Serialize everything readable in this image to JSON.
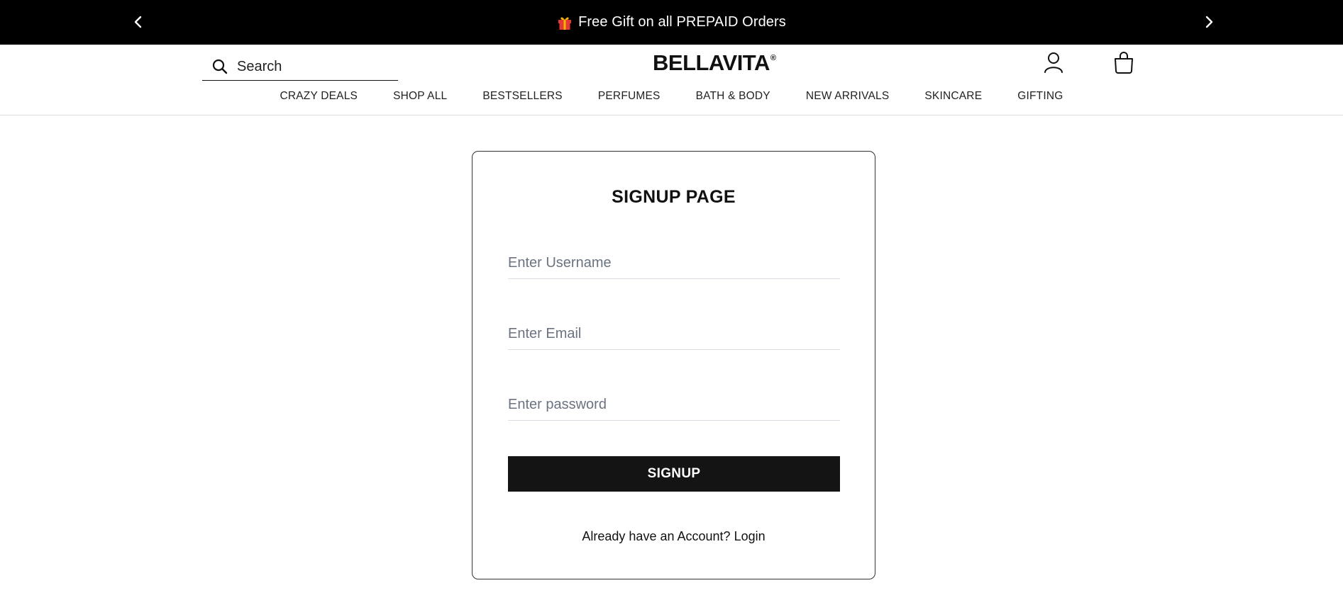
{
  "announcement": {
    "text": "Free Gift on all PREPAID Orders",
    "prev_icon": "chevron-left-icon",
    "next_icon": "chevron-right-icon",
    "gift_icon": "gift-icon"
  },
  "header": {
    "search_placeholder": "Search",
    "logo_text": "BELLAVITA",
    "logo_mark": "®",
    "nav": [
      "CRAZY DEALS",
      "SHOP ALL",
      "BESTSELLERS",
      "PERFUMES",
      "BATH & BODY",
      "NEW ARRIVALS",
      "SKINCARE",
      "GIFTING"
    ]
  },
  "signup": {
    "title": "SIGNUP PAGE",
    "username_placeholder": "Enter Username",
    "email_placeholder": "Enter Email",
    "password_placeholder": "Enter password",
    "button_label": "SIGNUP",
    "login_prompt": "Already have an Account?",
    "login_link": "Login"
  },
  "colors": {
    "announcement_bg": "#000000",
    "button_bg": "#141414",
    "card_border": "#333333",
    "field_underline": "#d9dde3",
    "gift_red": "#e53935",
    "gift_gold": "#f5b400"
  }
}
